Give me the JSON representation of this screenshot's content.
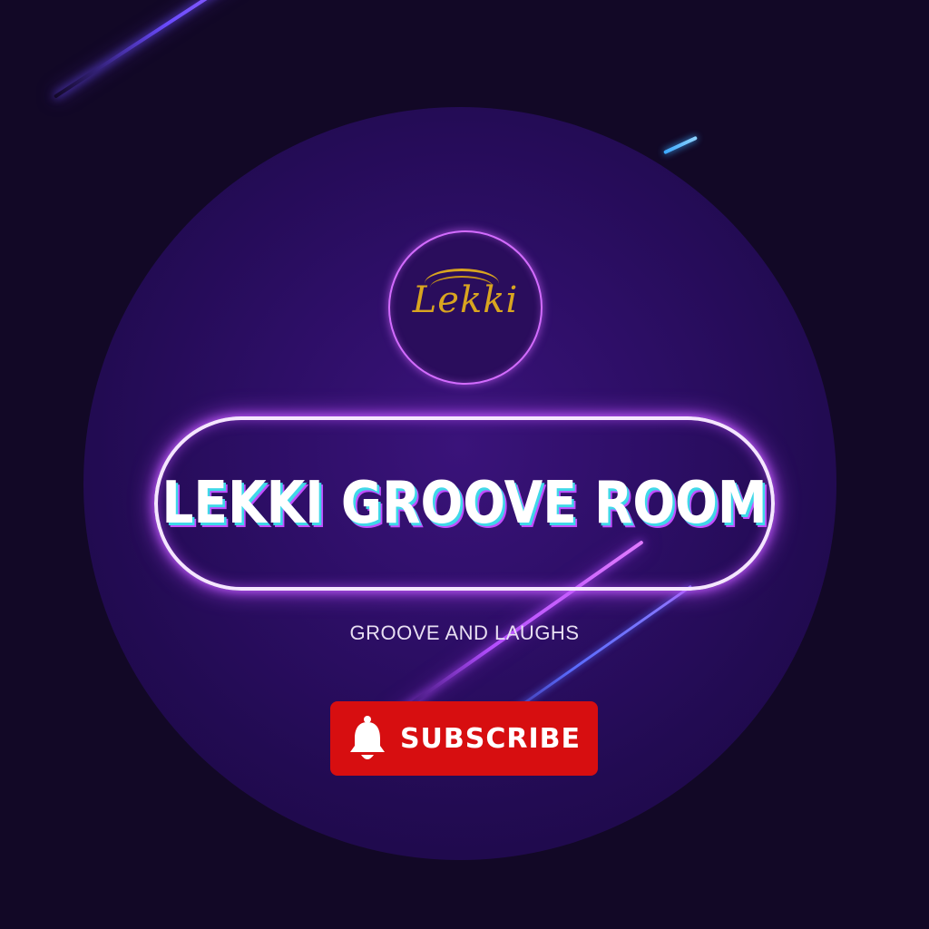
{
  "logo": {
    "text": "Lekki",
    "ring_color": "#d36cff",
    "text_color": "#d9a520"
  },
  "title": {
    "text": "LEKKI GROOVE ROOM"
  },
  "subtitle": {
    "text": "GROOVE AND LAUGHS"
  },
  "subscribe": {
    "label": "SUBSCRIBE",
    "icon": "bell-icon",
    "color": "#d70e10"
  },
  "colors": {
    "background": "#120826",
    "disc": "#2d0e66",
    "neon_pink": "#c45cff",
    "neon_blue": "#6a4bff"
  }
}
